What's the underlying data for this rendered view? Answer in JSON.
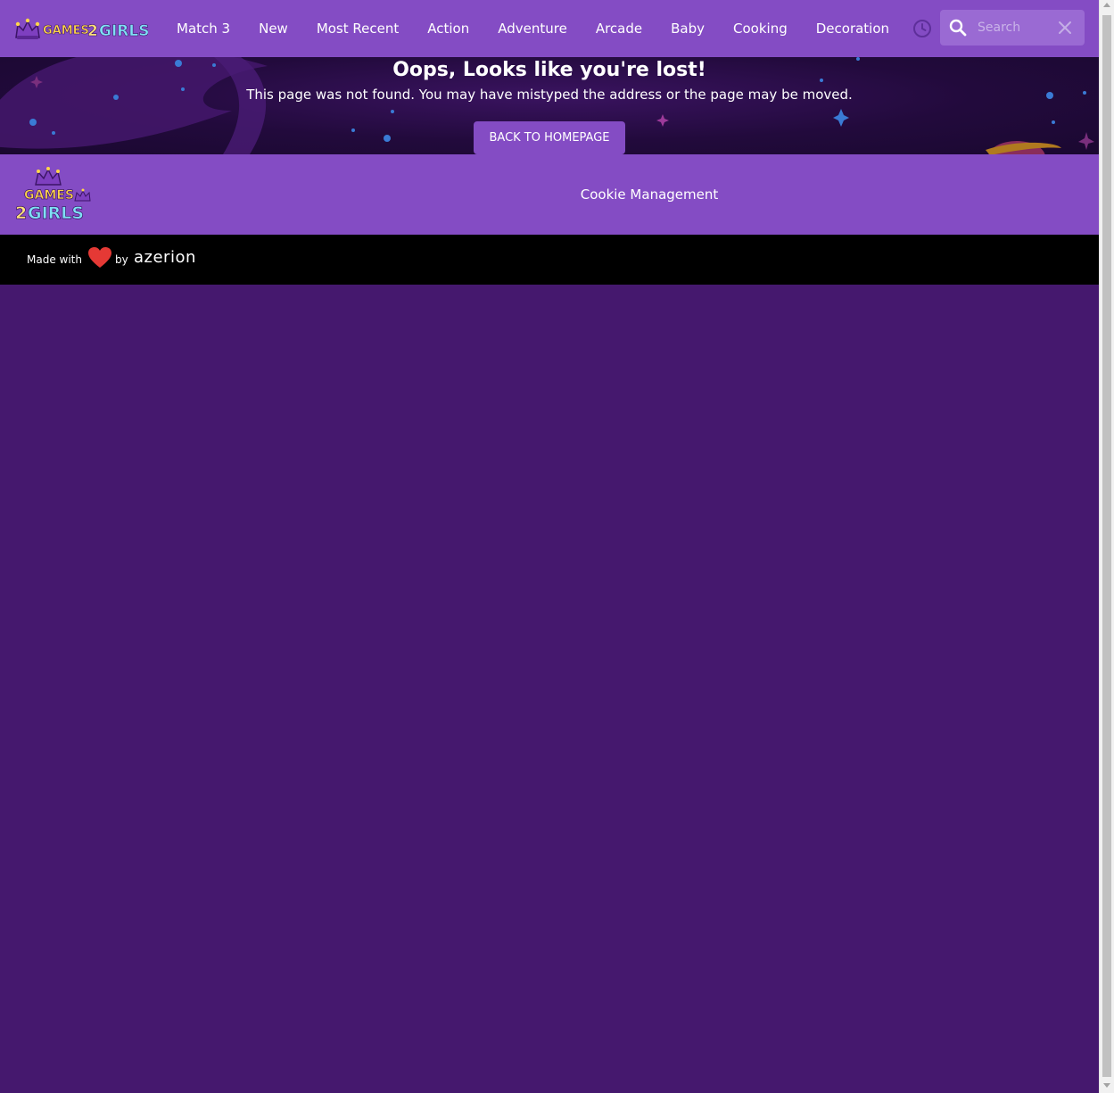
{
  "header": {
    "logo_text": "GAMES2GIRLS",
    "nav": [
      "Match 3",
      "New",
      "Most Recent",
      "Action",
      "Adventure",
      "Arcade",
      "Baby",
      "Cooking",
      "Decoration"
    ],
    "history_icon": "clock-icon",
    "search": {
      "placeholder": "Search",
      "value": "",
      "icon": "search-icon",
      "clear_icon": "close-icon"
    }
  },
  "hero": {
    "title": "Oops, Looks like you're lost!",
    "subtitle": "This page was not found. You may have mistyped the address or the page may be moved.",
    "button_label": "BACK TO HOMEPAGE"
  },
  "footer": {
    "logo_text": "GAMES 2GIRLS",
    "cookie_link": "Cookie Management",
    "made_with": "Made with",
    "heart_icon": "heart-icon",
    "by": "by",
    "brand": "azerion"
  },
  "colors": {
    "header_bg": "#844cc4",
    "page_bg": "#45186e",
    "search_bg": "#9a6ad3",
    "made_bar_bg": "#000000",
    "heart": "#e53935"
  }
}
